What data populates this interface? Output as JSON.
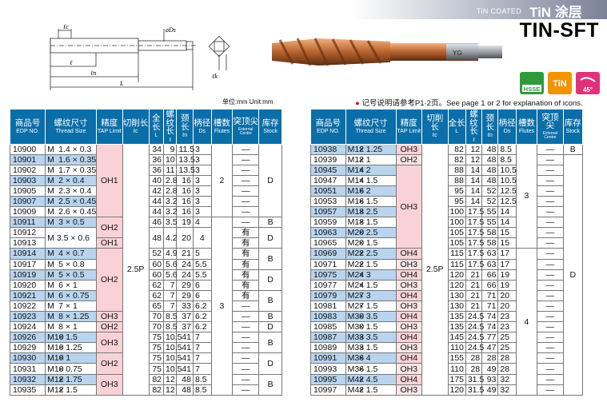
{
  "header": {
    "subtitle": "TiN COATED",
    "title": "TiN 涂层",
    "model": "TIN-SFT"
  },
  "drawing": {
    "labels": [
      "ℓc",
      "ℓ",
      "ℓn",
      "L",
      "øDs",
      "ℓk"
    ]
  },
  "product": {
    "shank_marking": "YG"
  },
  "icons": {
    "hsse": "HSSE",
    "tin": "TiN",
    "spiral": "45°",
    "colors": {
      "hsse": "#2e9a3b",
      "tin": "#f29400",
      "spiral": "#e3307a"
    }
  },
  "units_note": "单位:mm   Unit:mm",
  "note": {
    "bullet": "●",
    "text": "记号说明请参考P1·2页。See page 1 or 2 for explanation of icons."
  },
  "columns": {
    "edp_cn": "商品号",
    "edp_en": "EDP NO.",
    "size_cn": "螺纹尺寸",
    "size_en": "Thread Size",
    "tap_cn": "精度",
    "tap_en": "TAP Limit",
    "lc_cn": "切削长",
    "lc_en": "ℓc",
    "L_cn": "全长",
    "L_en": "L",
    "l_cn": "螺纹长",
    "l_en": "ℓ",
    "ln_cn": "颈长",
    "ln_en": "ℓn",
    "ds_cn": "柄径",
    "ds_en": "Ds",
    "fl_cn": "槽数",
    "fl_en": "Flutes",
    "ec_cn": "突顶尖",
    "ec_en": "External Centre",
    "st_cn": "库存",
    "st_en": "Stock"
  },
  "left_table": {
    "lc": "2.5P",
    "rows": [
      {
        "edp": "10900",
        "m": "M",
        "size": "1.4 × 0.3",
        "L": "34",
        "l": "9",
        "ln": "11.5",
        "ds": "3",
        "ec": "—"
      },
      {
        "edp": "10901",
        "m": "M",
        "size": "1.6 × 0.35",
        "L": "36",
        "l": "10",
        "ln": "13.5",
        "ds": "3",
        "ec": "—"
      },
      {
        "edp": "10902",
        "m": "M",
        "size": "1.7 × 0.35",
        "L": "36",
        "l": "11",
        "ln": "13.5",
        "ds": "3",
        "ec": "—"
      },
      {
        "edp": "10903",
        "m": "M",
        "size": "2 × 0.4",
        "L": "40",
        "l": "2.8",
        "ln": "16",
        "ds": "3",
        "ec": "—"
      },
      {
        "edp": "10905",
        "m": "M",
        "size": "2.3 × 0.4",
        "L": "42",
        "l": "2.8",
        "ln": "16",
        "ds": "3",
        "ec": "—"
      },
      {
        "edp": "10907",
        "m": "M",
        "size": "2.5 × 0.45",
        "L": "44",
        "l": "3.2",
        "ln": "16",
        "ds": "3",
        "ec": "—"
      },
      {
        "edp": "10909",
        "m": "M",
        "size": "2.6 × 0.45",
        "L": "44",
        "l": "3.2",
        "ln": "16",
        "ds": "3",
        "ec": "—"
      },
      {
        "edp": "10911",
        "m": "M",
        "size": "3 × 0.5",
        "L": "46",
        "l": "3.5",
        "ln": "19",
        "ds": "4",
        "ec": "—"
      },
      {
        "edp": "10912",
        "m": "",
        "size": "",
        "L": "",
        "l": "",
        "ln": "",
        "ds": "",
        "ec": "有"
      },
      {
        "edp": "10913",
        "m": "",
        "size": "",
        "L": "",
        "l": "",
        "ln": "",
        "ds": "",
        "ec": "有"
      },
      {
        "edp": "10914",
        "m": "M",
        "size": "4 × 0.7",
        "L": "52",
        "l": "4.9",
        "ln": "21",
        "ds": "5",
        "ec": "有"
      },
      {
        "edp": "10917",
        "m": "M",
        "size": "5 × 0.8",
        "L": "60",
        "l": "5.6",
        "ln": "24",
        "ds": "5.5",
        "ec": "有"
      },
      {
        "edp": "10919",
        "m": "M",
        "size": "5 × 0.5",
        "L": "60",
        "l": "5.6",
        "ln": "24",
        "ds": "5.5",
        "ec": "有"
      },
      {
        "edp": "10920",
        "m": "M",
        "size": "6 × 1",
        "L": "62",
        "l": "7",
        "ln": "29",
        "ds": "6",
        "ec": "有"
      },
      {
        "edp": "10921",
        "m": "M",
        "size": "6 × 0.75",
        "L": "62",
        "l": "7",
        "ln": "29",
        "ds": "6",
        "ec": "有"
      },
      {
        "edp": "10922",
        "m": "M",
        "size": "7 × 1",
        "L": "65",
        "l": "7",
        "ln": "33",
        "ds": "6.2",
        "ec": "—"
      },
      {
        "edp": "10923",
        "m": "M",
        "size": "8 × 1.25",
        "L": "70",
        "l": "8.5",
        "ln": "37",
        "ds": "6.2",
        "ec": "—"
      },
      {
        "edp": "10924",
        "m": "M",
        "size": "8 × 1",
        "L": "70",
        "l": "8.5",
        "ln": "37",
        "ds": "6.2",
        "ec": "—"
      },
      {
        "edp": "10926",
        "m": "M10",
        "size": "× 1.5",
        "L": "75",
        "l": "10.5",
        "ln": "41",
        "ds": "7",
        "ec": "—"
      },
      {
        "edp": "10929",
        "m": "M10",
        "size": "× 1.25",
        "L": "75",
        "l": "10.5",
        "ln": "41",
        "ds": "7",
        "ec": "—"
      },
      {
        "edp": "10930",
        "m": "M10",
        "size": "× 1",
        "L": "75",
        "l": "10.5",
        "ln": "41",
        "ds": "7",
        "ec": "—"
      },
      {
        "edp": "10931",
        "m": "M10",
        "size": "× 0.75",
        "L": "75",
        "l": "10.5",
        "ln": "41",
        "ds": "7",
        "ec": "—"
      },
      {
        "edp": "10932",
        "m": "M12",
        "size": "× 1.75",
        "L": "82",
        "l": "12",
        "ln": "48",
        "ds": "8.5",
        "ec": "—"
      },
      {
        "edp": "10935",
        "m": "M12",
        "size": "× 1.5",
        "L": "82",
        "l": "12",
        "ln": "48",
        "ds": "8.5",
        "ec": "—"
      }
    ],
    "merged_size": "M 3.5 × 0.6",
    "merged_L": "48",
    "merged_l": "4.2",
    "merged_ln": "20",
    "merged_ds": "4",
    "tap": [
      "OH1",
      "OH2",
      "OH1",
      "OH2",
      "OH3",
      "OH2",
      "OH3",
      "OH2",
      "OH3"
    ],
    "flutes": [
      "2",
      "3"
    ],
    "stock": [
      "D",
      "B",
      "D",
      "B",
      "D",
      "B",
      "D",
      "B",
      "D",
      "B",
      "D",
      "B"
    ]
  },
  "right_table": {
    "lc": "2.5P",
    "rows": [
      {
        "edp": "10938",
        "m": "M12",
        "size": "× 1.25",
        "tap": "OH3",
        "L": "82",
        "l": "12",
        "ln": "48",
        "ds": "8.5",
        "ec": "—"
      },
      {
        "edp": "10939",
        "m": "M12",
        "size": "× 1",
        "tap": "OH2",
        "L": "82",
        "l": "12",
        "ln": "48",
        "ds": "8.5",
        "ec": "—"
      },
      {
        "edp": "10945",
        "m": "M14",
        "size": "× 2",
        "tap": "",
        "L": "88",
        "l": "14",
        "ln": "48",
        "ds": "10.5",
        "ec": "—"
      },
      {
        "edp": "10947",
        "m": "M14",
        "size": "× 1.5",
        "tap": "",
        "L": "88",
        "l": "14",
        "ln": "48",
        "ds": "10.5",
        "ec": "—"
      },
      {
        "edp": "10951",
        "m": "M16",
        "size": "× 2",
        "tap": "",
        "L": "95",
        "l": "14",
        "ln": "52",
        "ds": "12.5",
        "ec": "—"
      },
      {
        "edp": "10953",
        "m": "M16",
        "size": "× 1.5",
        "tap": "",
        "L": "95",
        "l": "14",
        "ln": "52",
        "ds": "12.5",
        "ec": "—"
      },
      {
        "edp": "10957",
        "m": "M18",
        "size": "× 2.5",
        "tap": "",
        "L": "100",
        "l": "17.5",
        "ln": "55",
        "ds": "14",
        "ec": "—"
      },
      {
        "edp": "10959",
        "m": "M18",
        "size": "× 1.5",
        "tap": "",
        "L": "100",
        "l": "17.5",
        "ln": "55",
        "ds": "14",
        "ec": "—"
      },
      {
        "edp": "10963",
        "m": "M20",
        "size": "× 2.5",
        "tap": "",
        "L": "105",
        "l": "17.5",
        "ln": "58",
        "ds": "15",
        "ec": "—"
      },
      {
        "edp": "10965",
        "m": "M20",
        "size": "× 1.5",
        "tap": "",
        "L": "105",
        "l": "17.5",
        "ln": "58",
        "ds": "15",
        "ec": "—"
      },
      {
        "edp": "10969",
        "m": "M22",
        "size": "× 2.5",
        "tap": "OH4",
        "L": "115",
        "l": "17.5",
        "ln": "63",
        "ds": "17",
        "ec": "—"
      },
      {
        "edp": "10971",
        "m": "M22",
        "size": "× 1.5",
        "tap": "OH3",
        "L": "115",
        "l": "17.5",
        "ln": "63",
        "ds": "17",
        "ec": "—"
      },
      {
        "edp": "10975",
        "m": "M24",
        "size": "× 3",
        "tap": "OH4",
        "L": "120",
        "l": "21",
        "ln": "66",
        "ds": "19",
        "ec": "—"
      },
      {
        "edp": "10977",
        "m": "M24",
        "size": "× 1.5",
        "tap": "OH3",
        "L": "120",
        "l": "21",
        "ln": "66",
        "ds": "19",
        "ec": "—"
      },
      {
        "edp": "10979",
        "m": "M27",
        "size": "× 3",
        "tap": "OH4",
        "L": "130",
        "l": "21",
        "ln": "71",
        "ds": "20",
        "ec": "—"
      },
      {
        "edp": "10981",
        "m": "M27",
        "size": "× 1.5",
        "tap": "OH3",
        "L": "130",
        "l": "21",
        "ln": "71",
        "ds": "20",
        "ec": "—"
      },
      {
        "edp": "10983",
        "m": "M30",
        "size": "× 3.5",
        "tap": "OH4",
        "L": "135",
        "l": "24.5",
        "ln": "74",
        "ds": "23",
        "ec": "—"
      },
      {
        "edp": "10985",
        "m": "M30",
        "size": "× 1.5",
        "tap": "OH3",
        "L": "135",
        "l": "24.5",
        "ln": "74",
        "ds": "23",
        "ec": "—"
      },
      {
        "edp": "10987",
        "m": "M33",
        "size": "× 3.5",
        "tap": "OH4",
        "L": "145",
        "l": "24.5",
        "ln": "77",
        "ds": "25",
        "ec": "—"
      },
      {
        "edp": "10989",
        "m": "M33",
        "size": "× 1.5",
        "tap": "OH3",
        "L": "110",
        "l": "24.5",
        "ln": "47",
        "ds": "25",
        "ec": "—"
      },
      {
        "edp": "10991",
        "m": "M36",
        "size": "× 4",
        "tap": "OH4",
        "L": "155",
        "l": "28",
        "ln": "28",
        "ds": "28",
        "ec": "—"
      },
      {
        "edp": "10993",
        "m": "M36",
        "size": "× 1.5",
        "tap": "OH3",
        "L": "110",
        "l": "28",
        "ln": "49",
        "ds": "28",
        "ec": "—"
      },
      {
        "edp": "10995",
        "m": "M42",
        "size": "× 4.5",
        "tap": "OH4",
        "L": "175",
        "l": "31.5",
        "ln": "93",
        "ds": "32",
        "ec": "—"
      },
      {
        "edp": "10997",
        "m": "M42",
        "size": "× 1.5",
        "tap": "OH3",
        "L": "120",
        "l": "31.5",
        "ln": "49",
        "ds": "32",
        "ec": "—"
      }
    ],
    "merged_tap": "OH3",
    "flutes": [
      "3",
      "4"
    ],
    "stock": [
      "B",
      "D"
    ]
  }
}
